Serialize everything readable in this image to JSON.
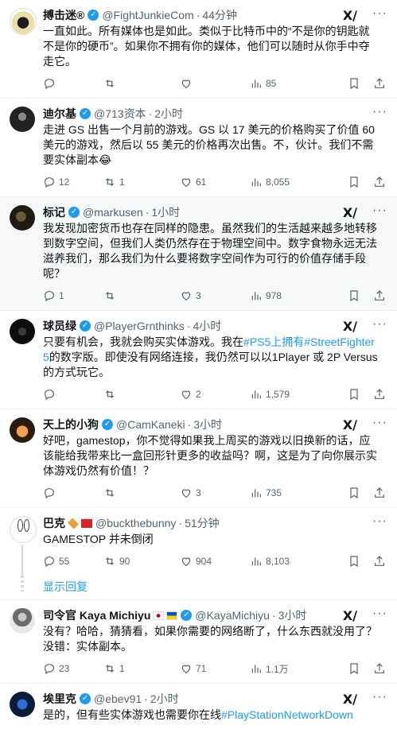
{
  "tweets": [
    {
      "name": "搏击迷®",
      "handle": "@FightJunkieCom",
      "time": "44分钟",
      "text": "一直如此。所有媒体也是如此。类似于比特币中的“不是你的钥匙就不是你的硬币”。如果你不拥有你的媒体，他们可以随时从你手中夺走它。",
      "reply_count": "",
      "retweet_count": "",
      "like_count": "",
      "view_count": "85"
    },
    {
      "name": "迪尔基",
      "handle": "@713资本",
      "time": "2小时",
      "text": "走进 GS 出售一个月前的游戏。GS 以 17 美元的价格购买了价值 60 美元的游戏，然后以 55 美元的价格再次出售。不，伙计。我们不需要实体副本😂",
      "reply_count": "12",
      "retweet_count": "1",
      "like_count": "61",
      "view_count": "8,055"
    },
    {
      "name": "标记",
      "handle": "@markusen",
      "time": "1小时",
      "text": "我发现加密货币也存在同样的隐患。虽然我们的生活越来越多地转移到数字空间，但我们人类仍然存在于物理空间中。数字食物永远无法滋养我们，那么我们为什么要将数字空间作为可行的价值存储手段呢？",
      "reply_count": "1",
      "retweet_count": "",
      "like_count": "3",
      "view_count": "978"
    },
    {
      "name": "球员绿",
      "handle": "@PlayerGrnthinks",
      "time": "4小时",
      "text_before": "只要有机会，我就会购买实体游戏。我在",
      "hashtag1": "#PS5上拥有",
      "hashtag2": "#StreetFighter5",
      "text_after": "的数字版。即使没有网络连接，我仍然可以以1Player 或 2P Versus 的方式玩它。",
      "reply_count": "",
      "retweet_count": "",
      "like_count": "2",
      "view_count": "1,579"
    },
    {
      "name": "天上的小狗",
      "handle": "@CamKaneki",
      "time": "3小时",
      "text": "好吧，gamestop，你不觉得如果我上周买的游戏以旧换新的话，应该能给我带来比一盒回形针更多的收益吗？啊，这是为了向你展示实体游戏仍然有价值！？",
      "reply_count": "",
      "retweet_count": "",
      "like_count": "3",
      "view_count": "735"
    },
    {
      "name": "巴克",
      "handle": "@buckthebunny",
      "time": "51分钟",
      "text": "GAMESTOP 并未倒闭",
      "reply_count": "55",
      "retweet_count": "90",
      "like_count": "904",
      "view_count": "8,103"
    },
    {
      "name": "司令官 Kaya Michiyu",
      "handle": "@KayaMichiyu",
      "time": "3小时",
      "text": "没有？哈哈，猜猜看，如果你需要的网络断了，什么东西就没用了？没错：实体副本。",
      "reply_count": "23",
      "retweet_count": "1",
      "like_count": "71",
      "view_count": "1.1万"
    },
    {
      "name": "埃里克",
      "handle": "@ebev91",
      "time": "2小时",
      "text_before": "是的，但有些实体游戏也需要你在线",
      "hashtag1": "#PlayStationNetworkDown"
    }
  ],
  "show_replies": "显示回复",
  "xlogo": "X"
}
